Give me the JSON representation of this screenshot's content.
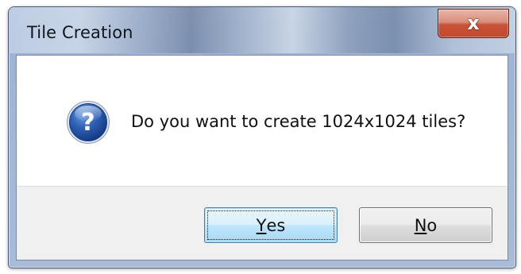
{
  "window": {
    "title": "Tile Creation"
  },
  "titlebar": {
    "close_glyph": "x",
    "close_icon": "close-icon"
  },
  "message": {
    "icon": "question-icon",
    "text": "Do you want to create 1024x1024 tiles?"
  },
  "buttons": {
    "yes": {
      "mnemonic": "Y",
      "rest": "es"
    },
    "no": {
      "mnemonic": "N",
      "rest": "o"
    }
  },
  "colors": {
    "accent": "#3c7fb1",
    "close": "#c85237",
    "icon_blue": "#1f4fa0"
  }
}
